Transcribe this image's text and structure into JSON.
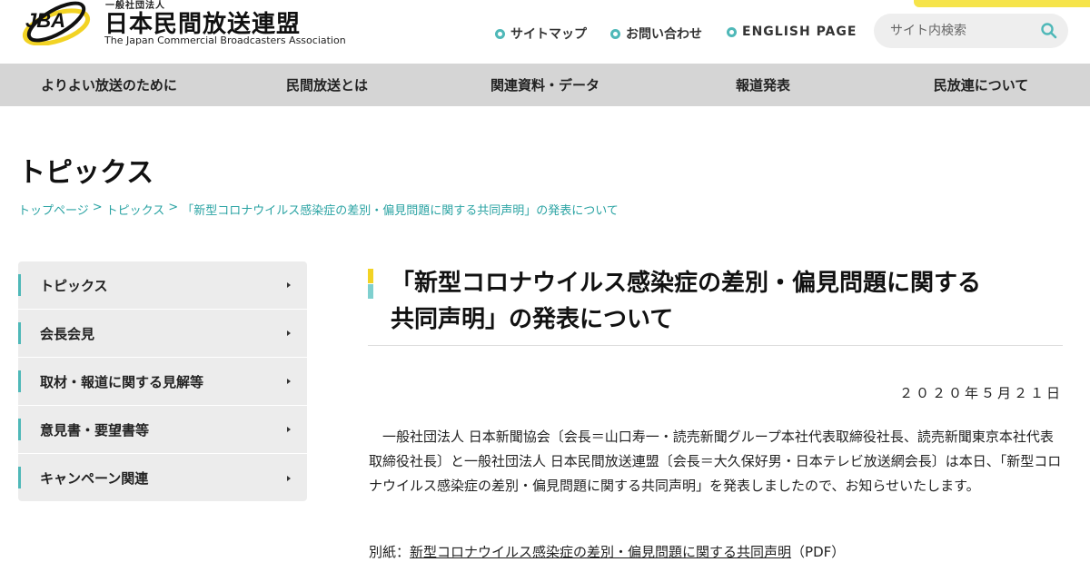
{
  "header": {
    "logo_text": "JBA",
    "org_small": "一般社団法人",
    "org_name": "日本民間放送連盟",
    "org_en": "The Japan Commercial Broadcasters Association",
    "links": [
      "サイトマップ",
      "お問い合わせ",
      "ENGLISH PAGE"
    ],
    "search_placeholder": "サイト内検索",
    "accent_yellow": "#f6e44a",
    "accent_teal": "#4fb8b8"
  },
  "nav": {
    "items": [
      "よりよい放送のために",
      "民間放送とは",
      "関連資料・データ",
      "報道発表",
      "民放連について"
    ]
  },
  "page": {
    "title": "トピックス",
    "breadcrumb": [
      "トップページ",
      "トピックス",
      "「新型コロナウイルス感染症の差別・偏見問題に関する共同声明」の発表について"
    ],
    "breadcrumb_sep": ">"
  },
  "sidebar": {
    "items": [
      "トピックス",
      "会長会見",
      "取材・報道に関する見解等",
      "意見書・要望書等",
      "キャンペーン関連"
    ]
  },
  "article": {
    "title_line1": "「新型コロナウイルス感染症の差別・偏見問題に関する",
    "title_line2": "共同声明」の発表について",
    "date": "２０２０年５月２１日",
    "body": "一般社団法人 日本新聞協会〔会長＝山口寿一・読売新聞グループ本社代表取締役社長、読売新聞東京本社代表取締役社長〕と一般社団法人 日本民間放送連盟〔会長＝大久保好男・日本テレビ放送網会長〕は本日、「新型コロナウイルス感染症の差別・偏見問題に関する共同声明」を発表しましたので、お知らせいたします。",
    "attach_prefix": "別紙：",
    "attach_link": "新型コロナウイルス感染症の差別・偏見問題に関する共同声明",
    "attach_suffix": "（PDF）"
  }
}
